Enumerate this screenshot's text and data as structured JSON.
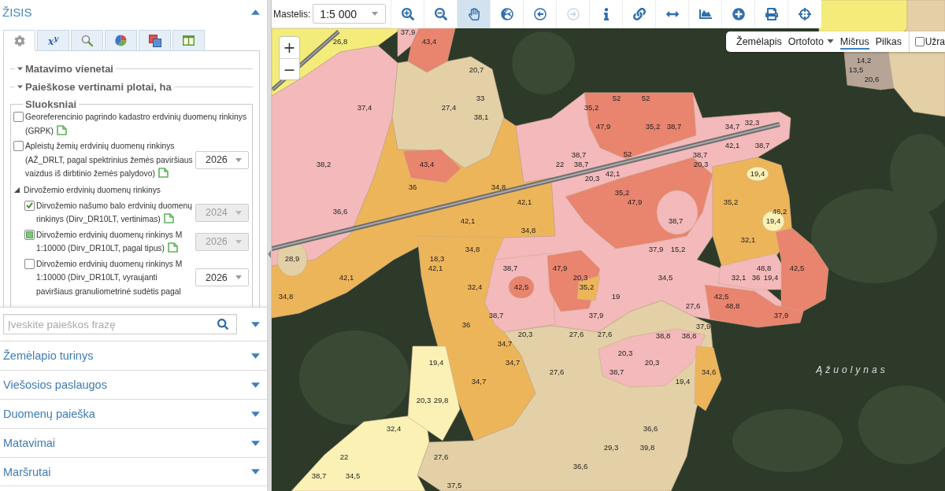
{
  "sidebar": {
    "title": "ŽISIS",
    "expanded": true,
    "tabs": [
      {
        "kind": "settings",
        "selected": true
      },
      {
        "kind": "formula",
        "label": "x$^{y}$",
        "selected": false
      },
      {
        "kind": "search",
        "selected": false
      },
      {
        "kind": "chart",
        "selected": false
      },
      {
        "kind": "layers",
        "selected": false
      },
      {
        "kind": "table",
        "selected": false
      }
    ],
    "sections": [
      {
        "title": "Matavimo vienetai",
        "expanded": false
      },
      {
        "title": "Paieškose vertinami plotai, ha",
        "expanded": false
      }
    ],
    "layers": {
      "title": "Sluoksniai",
      "items": [
        {
          "kind": "layer",
          "label": "Georeferencinio pagrindo kadastro erdvinių duomenų rinkinys (GRPK)",
          "checked": false,
          "mixed": false,
          "doc_link": true
        },
        {
          "kind": "layer",
          "label": "Apleistų žemių erdvinių duomenų rinkinys (AŽ_DRLT, pagal spektrinius žemės paviršiaus vaizdus iš dirbtinio žemės palydovo)",
          "checked": false,
          "mixed": false,
          "doc_link": true,
          "year": {
            "value": "2026",
            "disabled": false
          }
        },
        {
          "kind": "group",
          "label": "Dirvožemio erdvinių duomenų rinkinys",
          "expanded": true,
          "children": [
            {
              "kind": "layer",
              "label": "Dirvožemio našumo balo erdvinių duomenų rinkinys (Dirv_DR10LT, vertinimas)",
              "checked": true,
              "mixed": false,
              "doc_link": true,
              "year": {
                "value": "2024",
                "disabled": true
              }
            },
            {
              "kind": "layer",
              "label": "Dirvožemio erdvinių duomenų rinkinys M 1:10000 (Dirv_DR10LT, pagal tipus)",
              "checked": false,
              "mixed": true,
              "doc_link": true,
              "year": {
                "value": "2026",
                "disabled": true
              }
            },
            {
              "kind": "layer",
              "label": "Dirvožemio erdvinių duomenų rinkinys M 1:10000 (Dirv_DR10LT, vyraujanti paviršiaus granuliometrinė sudėtis pagal",
              "checked": false,
              "mixed": false,
              "doc_link": false,
              "year": {
                "value": "2026",
                "disabled": false
              }
            }
          ]
        }
      ]
    },
    "search": {
      "placeholder": "Įveskite paieškos frazę",
      "expanded": false
    },
    "panels": [
      {
        "title": "Žemėlapio turinys",
        "expanded": false
      },
      {
        "title": "Viešosios paslaugos",
        "expanded": false
      },
      {
        "title": "Duomenų paieška",
        "expanded": false
      },
      {
        "title": "Matavimai",
        "expanded": false
      },
      {
        "title": "Maršrutai",
        "expanded": false
      }
    ]
  },
  "toolbar": {
    "scale_label": "Mastelis:",
    "scale_value": "1:5 000",
    "tools": [
      {
        "kind": "zoom_in",
        "selected": false,
        "disabled": false
      },
      {
        "kind": "zoom_out",
        "selected": false,
        "disabled": false
      },
      {
        "kind": "pan",
        "selected": true,
        "disabled": false
      },
      {
        "kind": "full_extent",
        "selected": false,
        "disabled": false
      },
      {
        "kind": "previous",
        "selected": false,
        "disabled": false
      },
      {
        "kind": "next",
        "selected": false,
        "disabled": true
      },
      {
        "kind": "info",
        "selected": false,
        "disabled": false
      },
      {
        "kind": "link",
        "selected": false,
        "disabled": false
      },
      {
        "kind": "measure",
        "selected": false,
        "disabled": false
      },
      {
        "kind": "profile",
        "selected": false,
        "disabled": false
      },
      {
        "kind": "add",
        "selected": false,
        "disabled": false
      },
      {
        "kind": "print",
        "selected": false,
        "disabled": false
      },
      {
        "kind": "locate",
        "selected": false,
        "disabled": false
      }
    ]
  },
  "map": {
    "zoom_controls": [
      {
        "label": "+"
      },
      {
        "label": "−"
      }
    ],
    "basemaps": [
      {
        "label": "Žemėlapis",
        "selected": false,
        "dropdown": false
      },
      {
        "label": "Ortofoto",
        "selected": false,
        "dropdown": true
      },
      {
        "label": "Mišrus",
        "selected": true,
        "dropdown": false
      },
      {
        "label": "Pilkas",
        "selected": false,
        "dropdown": false
      }
    ],
    "labels_toggle": {
      "label": "Užra",
      "checked": false
    },
    "place_label": "Ąžuolynas",
    "value_labels": [
      "37,9",
      "26,8",
      "43,4",
      "14,2",
      "20,7",
      "13,5",
      "20,6",
      "33",
      "52",
      "52",
      "37,4",
      "27,4",
      "35,2",
      "38,1",
      "47,9",
      "35,2",
      "38,7",
      "34,7",
      "32,3",
      "42,1",
      "38,7",
      "38,7",
      "52",
      "38,7",
      "38,2",
      "43,4",
      "22",
      "38,7",
      "20,3",
      "20,3",
      "42,1",
      "19,4",
      "36",
      "34,8",
      "35,2",
      "42,1",
      "47,9",
      "35,2",
      "36,6",
      "46,2",
      "42,1",
      "38,7",
      "19,4",
      "34,8",
      "32,1",
      "34,8",
      "37,9",
      "15,2",
      "28,9",
      "18,3",
      "42,1",
      "38,7",
      "47,9",
      "48,8",
      "42,5",
      "42,1",
      "20,3",
      "34,5",
      "32,1",
      "36",
      "19,4",
      "32,4",
      "42,5",
      "35,2",
      "34,8",
      "19",
      "42,5",
      "27,6",
      "48,8",
      "38,7",
      "37,9",
      "37,9",
      "36",
      "37,9",
      "20,3",
      "27,6",
      "27,6",
      "38,8",
      "38,8",
      "34,7",
      "20,3",
      "19,4",
      "34,7",
      "20,3",
      "27,6",
      "38,7",
      "34,6",
      "34,7",
      "19,4",
      "20,3",
      "29,8",
      "32,4",
      "36,6",
      "29,3",
      "39,8",
      "22",
      "27,6",
      "36,6",
      "38,7",
      "34,5",
      "37,5"
    ]
  }
}
